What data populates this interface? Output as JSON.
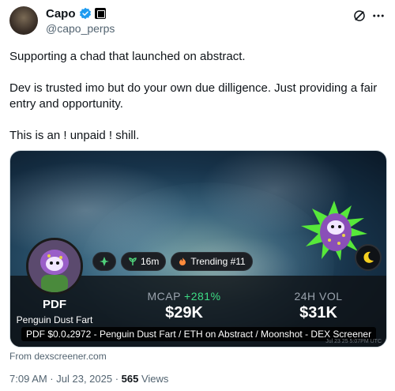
{
  "author": {
    "display_name": "Capo",
    "handle": "@capo_perps",
    "avatar_icon": "avatar",
    "verified_icon": "verified-badge-icon",
    "affiliate_icon": "affiliate-badge-icon"
  },
  "header_actions": {
    "grok_icon": "grok-icon",
    "more_icon": "more-icon"
  },
  "tweet": {
    "paragraphs": [
      "Supporting a chad that launched on abstract.",
      "Dev is trusted imo but do your own due dilligence. Just providing a fair entry and opportunity.",
      "This is an ! unpaid ! shill."
    ]
  },
  "card": {
    "token_symbol": "PDF",
    "token_name": "Penguin Dust Fart",
    "pill_age": "16m",
    "pill_trending": "Trending #11",
    "mcap_label": "MCAP",
    "mcap_change": "+281%",
    "mcap_value": "$29K",
    "vol_label": "24H VOL",
    "vol_value": "$31K",
    "caption": "PDF $0.0₄2972 - Penguin Dust Fart / ETH on Abstract / Moonshot - DEX Screener",
    "tiny_time": "Jul 23 25 5:07PM UTC",
    "colors": {
      "positive": "#3ddc84",
      "trending": "#ff8a3c",
      "age": "#4fd07a"
    }
  },
  "source": "From dexscreener.com",
  "meta": {
    "time": "7:09 AM · Jul 23, 2025 · ",
    "views_count": "565",
    "views_label": " Views"
  }
}
